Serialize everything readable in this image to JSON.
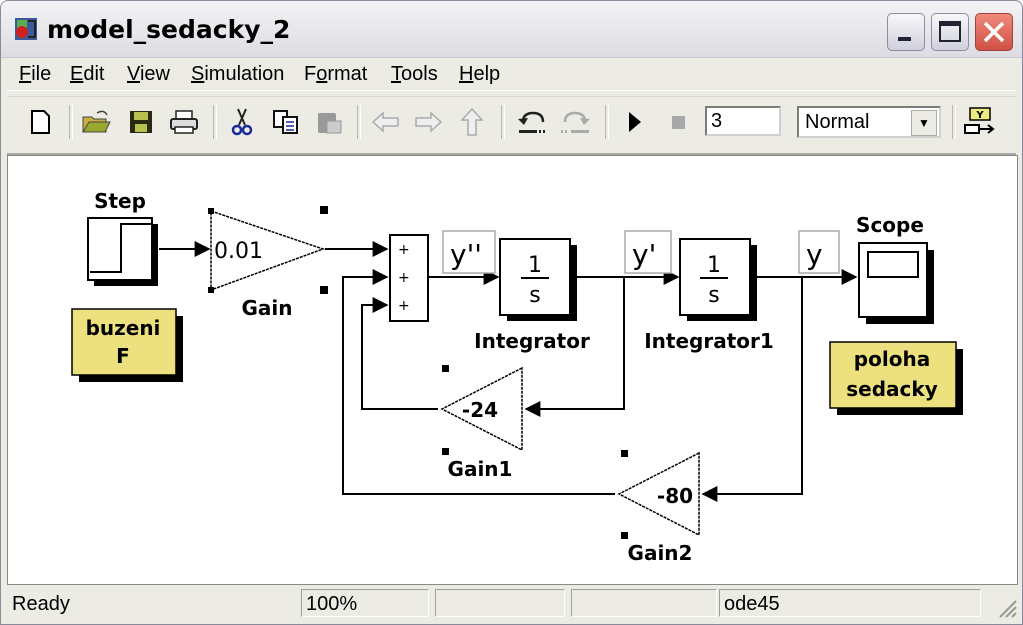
{
  "window": {
    "title": "model_sedacky_2",
    "app_icon": "simulink-model-icon",
    "controls": [
      "minimize",
      "maximize",
      "close"
    ]
  },
  "menubar": {
    "items": [
      {
        "label": "File",
        "mnemonic": "F"
      },
      {
        "label": "Edit",
        "mnemonic": "E"
      },
      {
        "label": "View",
        "mnemonic": "V"
      },
      {
        "label": "Simulation",
        "mnemonic": "S"
      },
      {
        "label": "Format",
        "mnemonic": "o"
      },
      {
        "label": "Tools",
        "mnemonic": "T"
      },
      {
        "label": "Help",
        "mnemonic": "H"
      }
    ]
  },
  "toolbar": {
    "buttons": [
      "new-icon",
      "open-icon",
      "save-icon",
      "print-icon",
      "cut-icon",
      "copy-icon",
      "paste-icon",
      "back-icon",
      "forward-icon",
      "up-icon",
      "undo-icon",
      "redo-icon",
      "start-simulation-icon",
      "stop-simulation-icon"
    ],
    "stop_time": "3",
    "simulation_mode": "Normal",
    "library_browser_icon": "library-browser-icon"
  },
  "diagram": {
    "blocks": {
      "step": {
        "name": "Step"
      },
      "gain": {
        "name": "Gain",
        "value": "0.01"
      },
      "sum": {
        "signs": [
          "+",
          "+",
          "+"
        ]
      },
      "integrator": {
        "name": "Integrator",
        "num": "1",
        "den": "s"
      },
      "integrator1": {
        "name": "Integrator1",
        "num": "1",
        "den": "s"
      },
      "scope": {
        "name": "Scope"
      },
      "gain1": {
        "name": "Gain1",
        "value": "-24"
      },
      "gain2": {
        "name": "Gain2",
        "value": "-80"
      }
    },
    "signal_labels": {
      "ydd": "y''",
      "yd": "y'",
      "y": "y"
    },
    "annotations": {
      "buzeni": [
        "buzeni",
        "F"
      ],
      "poloha": [
        "poloha",
        "sedacky"
      ]
    },
    "colors": {
      "annotation_bg": "#ede07e",
      "line": "#000000"
    }
  },
  "statusbar": {
    "status": "Ready",
    "zoom": "100%",
    "panel3": "",
    "panel4": "",
    "solver": "ode45"
  }
}
